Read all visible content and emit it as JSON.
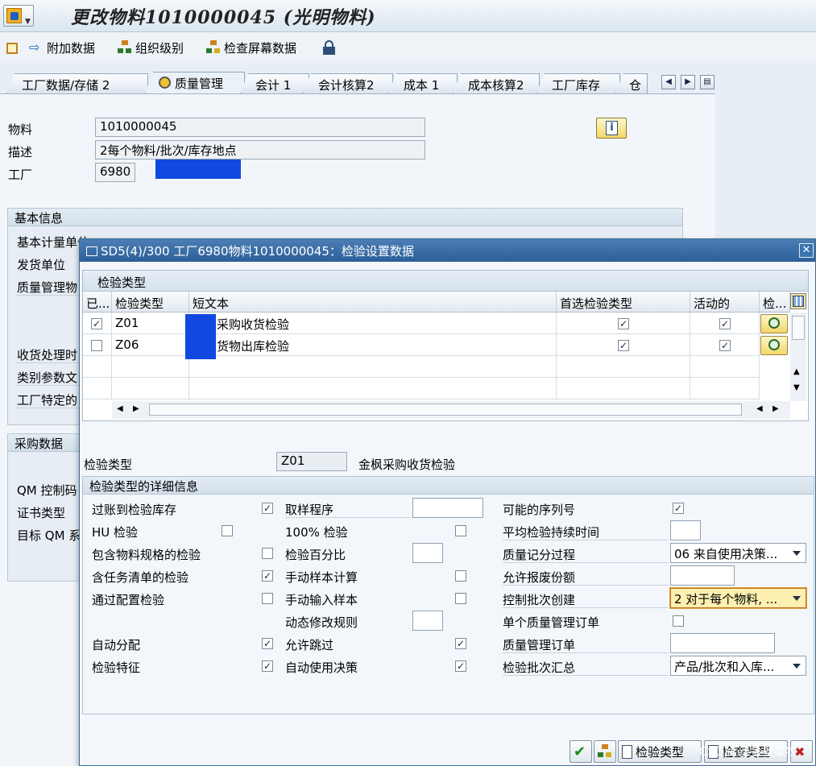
{
  "window": {
    "title": "更改物料1010000045 (光明物料)"
  },
  "toolbar": {
    "items": [
      "附加数据",
      "组织级别",
      "检查屏幕数据"
    ]
  },
  "tabs": [
    "工厂数据/存储 2",
    "质量管理",
    "会计 1",
    "会计核算2",
    "成本 1",
    "成本核算2",
    "工厂库存",
    "仓"
  ],
  "header": {
    "material_label": "物料",
    "material_value": "1010000045",
    "desc_label": "描述",
    "desc_value": "2每个物料/批次/库存地点",
    "plant_label": "工厂",
    "plant_value": "6980"
  },
  "basic": {
    "title": "基本信息",
    "rows": [
      "基本计量单位",
      "发货单位",
      "质量管理物",
      "收货处理时",
      "类别参数文",
      "工厂特定的"
    ]
  },
  "purchase": {
    "title": "采购数据",
    "rows": [
      "QM 控制码",
      "证书类型",
      "目标 QM 系"
    ]
  },
  "dialog": {
    "title": "SD5(4)/300 工厂6980物料1010000045：检验设置数据",
    "table": {
      "caption": "检验类型",
      "headers": [
        "已...",
        "检验类型",
        "短文本",
        "首选检验类型",
        "活动的",
        "检..."
      ],
      "rows": [
        {
          "checked": "✓",
          "type": "Z01",
          "text": "采购收货检验",
          "preferred": "✓",
          "active": "✓"
        },
        {
          "checked": "",
          "type": "Z06",
          "text": "货物出库检验",
          "preferred": "✓",
          "active": "✓"
        }
      ]
    },
    "insp_type_label": "检验类型",
    "insp_type_value": "Z01",
    "insp_type_text": "金枫采购收货检验",
    "details": {
      "title": "检验类型的详细信息",
      "col1": [
        {
          "label": "过账到检验库存",
          "checked": "✓"
        },
        {
          "label": "HU 检验",
          "checked": ""
        },
        {
          "label": "包含物料规格的检验",
          "checked": ""
        },
        {
          "label": "含任务清单的检验",
          "checked": "✓"
        },
        {
          "label": "通过配置检验",
          "checked": ""
        },
        {
          "label": "自动分配",
          "checked": "✓"
        },
        {
          "label": "检验特征",
          "checked": "✓"
        }
      ],
      "col2": [
        {
          "label": "取样程序",
          "value": ""
        },
        {
          "label": "100% 检验",
          "checked": ""
        },
        {
          "label": "检验百分比",
          "value": ""
        },
        {
          "label": "手动样本计算",
          "checked": ""
        },
        {
          "label": "手动输入样本",
          "checked": ""
        },
        {
          "label": "动态修改规则",
          "value": ""
        },
        {
          "label": "允许跳过",
          "checked": "✓"
        },
        {
          "label": "自动使用决策",
          "checked": "✓"
        }
      ],
      "col3": [
        {
          "label": "可能的序列号",
          "checked": "✓"
        },
        {
          "label": "平均检验持续时间",
          "value": ""
        },
        {
          "label": "质量记分过程",
          "value": "06 来自使用决策..."
        },
        {
          "label": "允许报废份额",
          "value": ""
        },
        {
          "label": "控制批次创建",
          "value": "2 对于每个物料, ..."
        },
        {
          "label": "单个质量管理订单",
          "checked": ""
        },
        {
          "label": "质量管理订单",
          "value": ""
        },
        {
          "label": "检验批次汇总",
          "value": "产品/批次和入库..."
        }
      ]
    },
    "footer": {
      "btn_insp_type": "检验类型",
      "btn_check_type": "检查类型"
    }
  },
  "watermark": "CSDN @金枫菜农",
  "colors": {
    "redact": "#1048e0",
    "title_bar": "#2b5f98"
  }
}
